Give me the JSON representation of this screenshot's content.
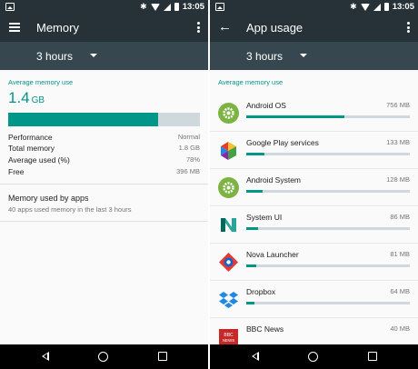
{
  "statusbar": {
    "time": "13:05"
  },
  "left": {
    "title": "Memory",
    "range": "3 hours",
    "section_label": "Average memory use",
    "average_value": "1.4",
    "average_unit": "GB",
    "memory_fraction": 0.78,
    "stats": [
      {
        "label": "Performance",
        "value": "Normal"
      },
      {
        "label": "Total memory",
        "value": "1.8 GB"
      },
      {
        "label": "Average used (%)",
        "value": "78%"
      },
      {
        "label": "Free",
        "value": "396 MB"
      }
    ],
    "used_by_apps": {
      "title": "Memory used by apps",
      "subtitle": "40 apps used memory in the last 3 hours"
    }
  },
  "right": {
    "title": "App usage",
    "range": "3 hours",
    "section_label": "Average memory use",
    "apps": [
      {
        "name": "Android OS",
        "size": "756 MB",
        "fraction": 0.6,
        "icon": "android-gear-icon"
      },
      {
        "name": "Google Play services",
        "size": "133 MB",
        "fraction": 0.11,
        "icon": "google-play-services-icon"
      },
      {
        "name": "Android System",
        "size": "128 MB",
        "fraction": 0.1,
        "icon": "android-gear-icon"
      },
      {
        "name": "System UI",
        "size": "86 MB",
        "fraction": 0.07,
        "icon": "system-ui-icon"
      },
      {
        "name": "Nova Launcher",
        "size": "81 MB",
        "fraction": 0.06,
        "icon": "nova-launcher-icon"
      },
      {
        "name": "Dropbox",
        "size": "64 MB",
        "fraction": 0.05,
        "icon": "dropbox-icon"
      },
      {
        "name": "BBC News",
        "size": "40 MB",
        "fraction": 0.03,
        "icon": "bbc-news-icon"
      }
    ]
  },
  "icon_text": {
    "bbc_top": "BBC",
    "bbc_bottom": "NEWS"
  },
  "colors": {
    "accent": "#009688",
    "toolbar": "#263238",
    "subbar": "#37474f",
    "track": "#cfd8dc"
  }
}
